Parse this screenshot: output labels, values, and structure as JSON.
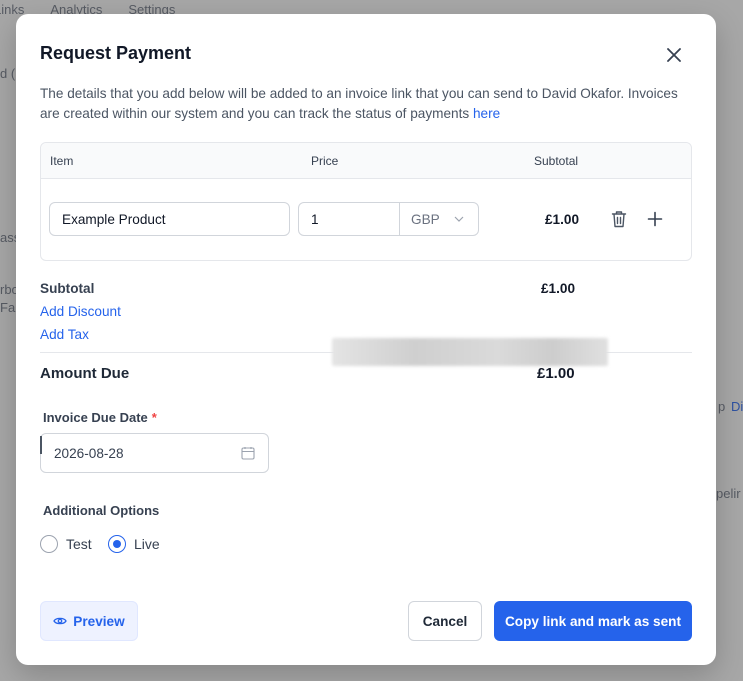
{
  "background": {
    "tabs": [
      "Links",
      "Analytics",
      "Settings"
    ],
    "fragments": [
      "d (",
      "ass",
      "rbo",
      "Fai",
      "p",
      "Di",
      "pelir"
    ]
  },
  "modal": {
    "title": "Request Payment",
    "description_part1": "The details that you add below will be added to an invoice link that you can send to David Okafor. Invoices are created within our system and you can track the status of payments ",
    "description_link": "here",
    "table": {
      "headers": {
        "item": "Item",
        "price": "Price",
        "subtotal": "Subtotal"
      },
      "rows": [
        {
          "item": "Example Product",
          "price": "1",
          "currency": "GBP",
          "subtotal": "£1.00"
        }
      ]
    },
    "totals": {
      "subtotal_label": "Subtotal",
      "subtotal_value": "£1.00",
      "add_discount": "Add Discount",
      "add_tax": "Add Tax",
      "amount_due_label": "Amount Due",
      "amount_due_value": "£1.00"
    },
    "due_date": {
      "label": "Invoice Due Date",
      "required_mark": "*",
      "value": "2026-08-28"
    },
    "options": {
      "label": "Additional Options",
      "radios": [
        {
          "label": "Test",
          "checked": false
        },
        {
          "label": "Live",
          "checked": true
        }
      ]
    },
    "buttons": {
      "preview": "Preview",
      "cancel": "Cancel",
      "primary": "Copy link and mark as sent"
    }
  },
  "colors": {
    "accent": "#2563eb",
    "required": "#ef4444"
  },
  "icons": {
    "close": "close-icon",
    "trash": "trash-icon",
    "plus": "plus-icon",
    "chevron": "chevron-down-icon",
    "calendar": "calendar-icon",
    "eye": "eye-icon"
  }
}
